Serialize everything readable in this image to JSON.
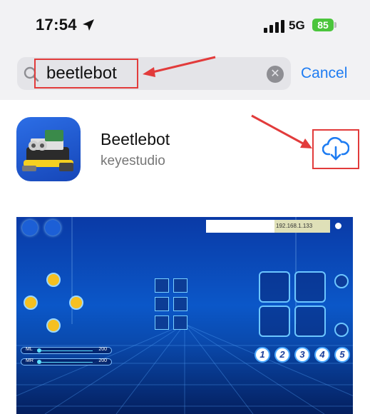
{
  "status_bar": {
    "time": "17:54",
    "network": "5G",
    "battery": "85"
  },
  "search": {
    "query": "beetlebot",
    "cancel_label": "Cancel"
  },
  "result": {
    "app_name": "Beetlebot",
    "developer": "keyestudio"
  },
  "screenshot": {
    "ip_address": "192.168.1.133",
    "sliders": [
      {
        "label": "ML",
        "value": "200"
      },
      {
        "label": "MR",
        "value": "200"
      }
    ],
    "mode_numbers": [
      "1",
      "2",
      "3",
      "4",
      "5"
    ]
  },
  "colors": {
    "accent": "#1e7cf2",
    "annotation": "#e23b3b",
    "battery": "#4bc53c"
  }
}
